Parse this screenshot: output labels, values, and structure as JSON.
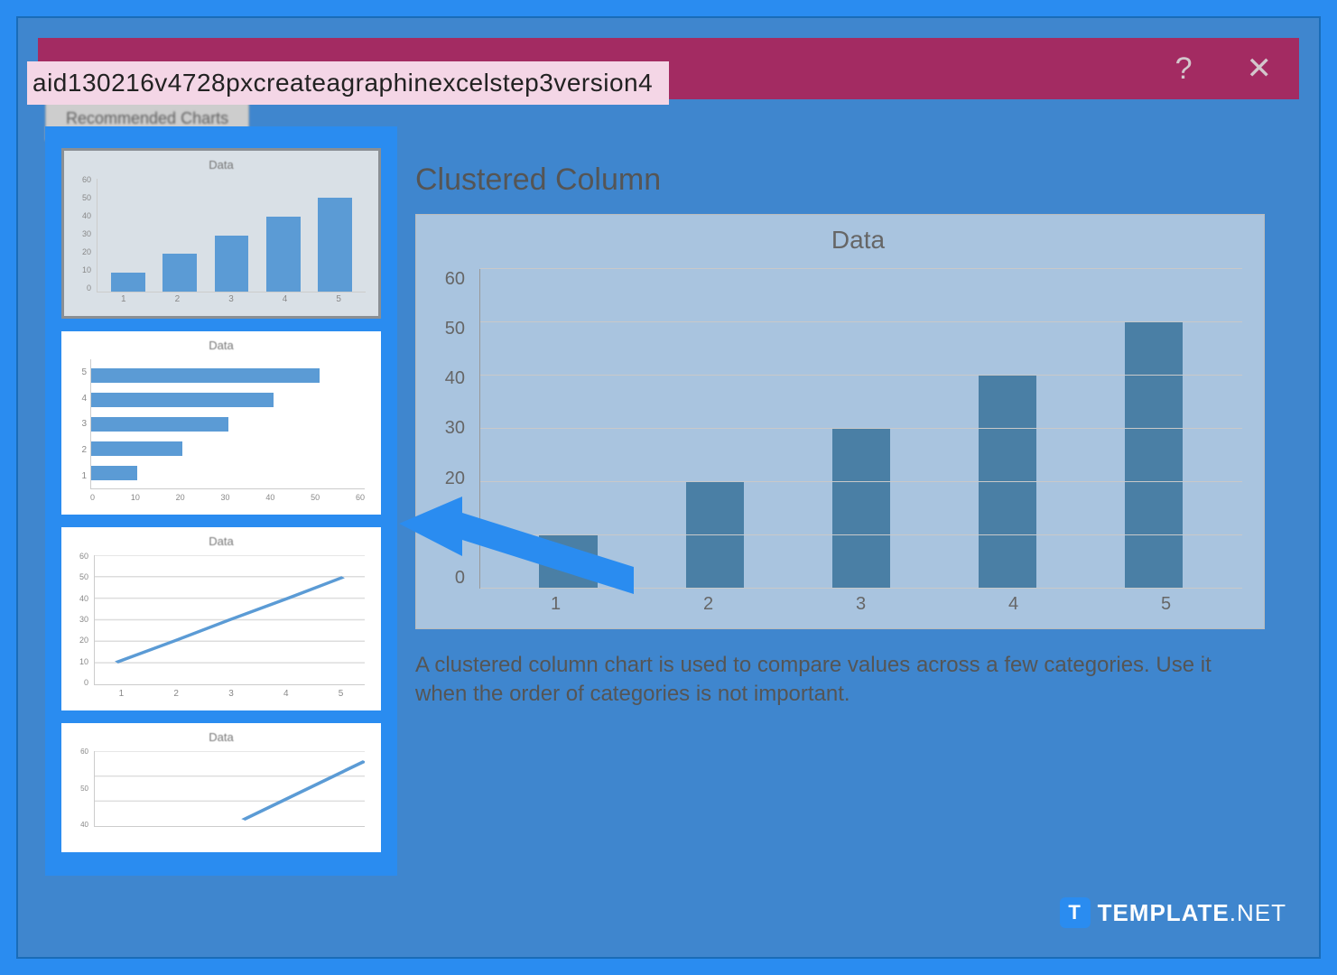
{
  "url_overlay": "aid130216v4728pxcreateagraphinexcelstep3version4",
  "dialog": {
    "help_symbol": "?",
    "close_symbol": "✕",
    "tab_label": "Recommended Charts"
  },
  "thumbnails": [
    {
      "title": "Data",
      "type": "column",
      "selected": true
    },
    {
      "title": "Data",
      "type": "bar"
    },
    {
      "title": "Data",
      "type": "line"
    },
    {
      "title": "Data",
      "type": "line-partial"
    }
  ],
  "preview": {
    "heading": "Clustered Column",
    "chart_title": "Data",
    "description": "A clustered column chart is used to compare values across a few categories. Use it when the order of categories is not important."
  },
  "watermark": {
    "icon_letter": "T",
    "text_bold": "TEMPLATE",
    "text_thin": ".NET"
  },
  "chart_data": [
    {
      "name": "main_preview",
      "type": "bar",
      "title": "Data",
      "categories": [
        "1",
        "2",
        "3",
        "4",
        "5"
      ],
      "values": [
        10,
        20,
        30,
        40,
        50
      ],
      "xlabel": "",
      "ylabel": "",
      "ylim": [
        0,
        60
      ],
      "yticks": [
        0,
        10,
        20,
        30,
        40,
        50,
        60
      ]
    },
    {
      "name": "thumb_column",
      "type": "bar",
      "title": "Data",
      "categories": [
        "1",
        "2",
        "3",
        "4",
        "5"
      ],
      "values": [
        10,
        20,
        30,
        40,
        50
      ],
      "ylim": [
        0,
        60
      ]
    },
    {
      "name": "thumb_hbar",
      "type": "bar",
      "orientation": "horizontal",
      "title": "Data",
      "categories": [
        "5",
        "4",
        "3",
        "2",
        "1"
      ],
      "values": [
        50,
        40,
        30,
        20,
        10
      ],
      "xlim": [
        0,
        60
      ],
      "xticks": [
        0,
        10,
        20,
        30,
        40,
        50,
        60
      ]
    },
    {
      "name": "thumb_line",
      "type": "line",
      "title": "Data",
      "x": [
        1,
        2,
        3,
        4,
        5
      ],
      "values": [
        10,
        20,
        30,
        40,
        50
      ],
      "ylim": [
        0,
        60
      ]
    }
  ]
}
